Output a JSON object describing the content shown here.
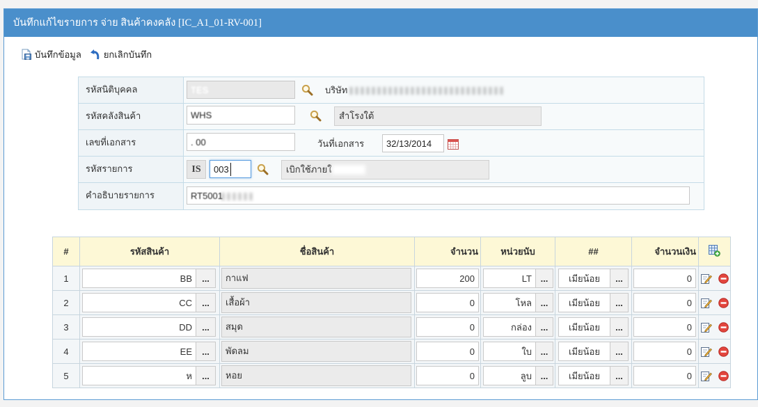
{
  "window": {
    "title": "บันทึกแก้ไขรายการ จ่าย สินค้าคงคลัง [IC_A1_01-RV-001]"
  },
  "toolbar": {
    "save_label": "บันทึกข้อมูล",
    "save_icon": "save-document-icon",
    "cancel_label": "ยกเลิกบันทึก",
    "cancel_icon": "undo-arrow-icon"
  },
  "form": {
    "company": {
      "label": "รหัสนิติบุคคล",
      "code": "TES",
      "name": "บริษัท"
    },
    "warehouse": {
      "label": "รหัสคลังสินค้า",
      "code": "WHS",
      "name": "สำโรงใต้"
    },
    "document": {
      "label": "เลขที่เอกสาร",
      "number": ". 00",
      "date_label": "วันที่เอกสาร",
      "date": "32/13/2014",
      "date_icon": "calendar-icon"
    },
    "transaction": {
      "label": "รหัสรายการ",
      "prefix": "IS",
      "code": "003",
      "name": "เบิกใช้ภายใ"
    },
    "description": {
      "label": "คำอธิบายรายการ",
      "text": "RT5001"
    },
    "lookup_icon": "search-icon"
  },
  "items": {
    "columns": {
      "no": "#",
      "code": "รหัสสินค้า",
      "name": "ชื่อสินค้า",
      "qty": "จำนวน",
      "unit": "หน่วยนับ",
      "extra": "##",
      "amount": "จำนวนเงิน"
    },
    "browse_label": "...",
    "add_icon": "add-row-icon",
    "edit_icon": "edit-icon",
    "delete_icon": "delete-icon",
    "rows": [
      {
        "no": "1",
        "code": "BB",
        "name": "กาแฟ",
        "qty": "200",
        "unit": "LT",
        "extra": "เมียน้อย",
        "amount": "0"
      },
      {
        "no": "2",
        "code": "CC",
        "name": "เสื้อผ้า",
        "qty": "0",
        "unit": "โหล",
        "extra": "เมียน้อย",
        "amount": "0"
      },
      {
        "no": "3",
        "code": "DD",
        "name": "สมุด",
        "qty": "0",
        "unit": "กล่อง",
        "extra": "เมียน้อย",
        "amount": "0"
      },
      {
        "no": "4",
        "code": "EE",
        "name": "พัดลม",
        "qty": "0",
        "unit": "ใบ",
        "extra": "เมียน้อย",
        "amount": "0"
      },
      {
        "no": "5",
        "code": "ห",
        "name": "หอย",
        "qty": "0",
        "unit": "ลูบ",
        "extra": "เมียน้อย",
        "amount": "0"
      }
    ]
  },
  "colors": {
    "header_bar": "#4a8fcb",
    "grid_header": "#fdf8d6",
    "focus_border": "#5a9de0",
    "delete_red": "#e2453d"
  }
}
